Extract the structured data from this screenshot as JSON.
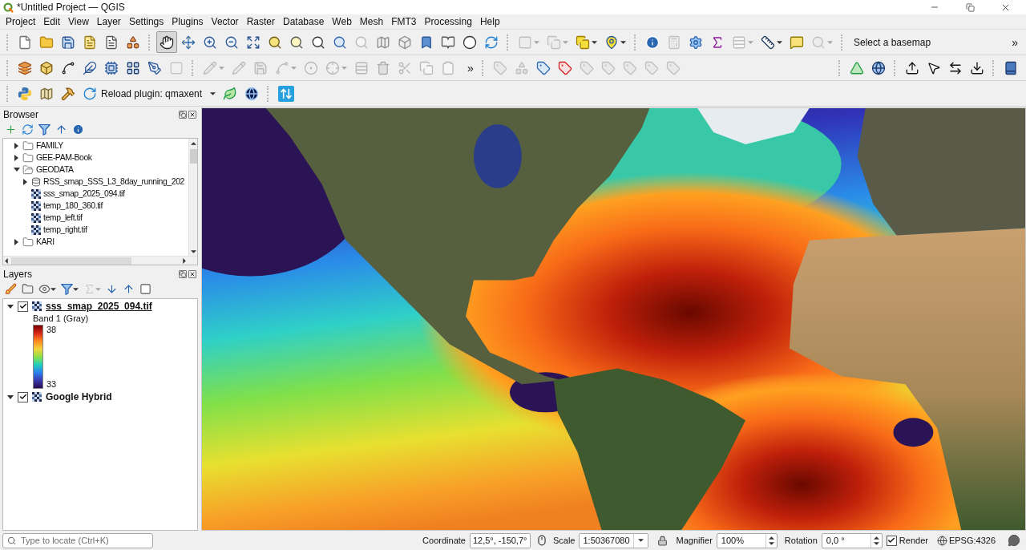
{
  "window": {
    "title": "*Untitled Project — QGIS"
  },
  "menu": [
    "Project",
    "Edit",
    "View",
    "Layer",
    "Settings",
    "Plugins",
    "Vector",
    "Raster",
    "Database",
    "Web",
    "Mesh",
    "FMT3",
    "Processing",
    "Help"
  ],
  "toolbars": [
    {
      "groups": [
        {
          "buttons": [
            {
              "kind": "new",
              "disabled": false
            },
            {
              "kind": "open",
              "disabled": false
            },
            {
              "kind": "save",
              "disabled": false
            },
            {
              "kind": "layout",
              "disabled": false
            },
            {
              "kind": "layouts",
              "disabled": false
            },
            {
              "kind": "styles",
              "disabled": false
            }
          ]
        },
        {
          "buttons": [
            {
              "kind": "pan",
              "disabled": false,
              "selected": true
            },
            {
              "kind": "panselect",
              "disabled": false,
              "selected": false
            },
            {
              "kind": "zoomin",
              "disabled": false,
              "selected": false
            },
            {
              "kind": "zoomout",
              "disabled": false,
              "selected": false
            },
            {
              "kind": "zoomfull",
              "disabled": false,
              "selected": false
            },
            {
              "kind": "zoomlayer",
              "disabled": false,
              "selected": false
            },
            {
              "kind": "zoomselect",
              "disabled": false,
              "selected": false
            },
            {
              "kind": "zoomnative",
              "disabled": false,
              "selected": false
            },
            {
              "kind": "zoomlast",
              "disabled": false,
              "selected": false
            },
            {
              "kind": "zoomnext",
              "disabled": true,
              "selected": false
            },
            {
              "kind": "mapview",
              "disabled": false,
              "selected": false
            },
            {
              "kind": "map3d",
              "disabled": false,
              "selected": false
            },
            {
              "kind": "bookmark",
              "disabled": false,
              "selected": false
            },
            {
              "kind": "bookmarks",
              "disabled": false,
              "selected": false
            },
            {
              "kind": "temporal",
              "disabled": false,
              "selected": false
            },
            {
              "kind": "refresh",
              "disabled": false,
              "selected": false
            }
          ]
        },
        {
          "buttons": [
            {
              "kind": "select",
              "disabled": true,
              "dropdown": true
            },
            {
              "kind": "selectattr",
              "disabled": true,
              "dropdown": true
            },
            {
              "kind": "deselect",
              "disabled": false,
              "dropdown": true
            },
            {
              "kind": "selectlocation",
              "disabled": false,
              "dropdown": true
            }
          ]
        },
        {
          "buttons": [
            {
              "kind": "identify",
              "disabled": false
            },
            {
              "kind": "attrtable",
              "disabled": true
            },
            {
              "kind": "toolbox",
              "disabled": false
            },
            {
              "kind": "statistics",
              "disabled": false
            },
            {
              "kind": "fieldcalc",
              "disabled": true,
              "dropdown": true
            },
            {
              "kind": "measure",
              "disabled": false,
              "dropdown": true
            },
            {
              "kind": "annotation",
              "disabled": false
            },
            {
              "kind": "locator",
              "disabled": true,
              "dropdown": true
            }
          ]
        },
        {
          "text": "Select a basemap",
          "overflow": "»"
        }
      ]
    },
    {
      "groups": [
        {
          "buttons": [
            {
              "kind": "datasource",
              "disabled": false
            },
            {
              "kind": "geopackage",
              "disabled": false
            },
            {
              "kind": "shapefile",
              "disabled": false
            },
            {
              "kind": "scratch",
              "disabled": false
            },
            {
              "kind": "virtual",
              "disabled": false
            },
            {
              "kind": "mesh",
              "disabled": false
            },
            {
              "kind": "gpx",
              "disabled": false
            },
            {
              "kind": "vertexbox",
              "disabled": true
            }
          ]
        },
        {
          "buttons": [
            {
              "kind": "editpencil",
              "disabled": true,
              "dropdown": true
            },
            {
              "kind": "toggleedit",
              "disabled": true
            },
            {
              "kind": "saveedits",
              "disabled": true
            },
            {
              "kind": "digitize",
              "disabled": true,
              "dropdown": true
            },
            {
              "kind": "addpoints",
              "disabled": true
            },
            {
              "kind": "vertextool",
              "disabled": true,
              "dropdown": true
            },
            {
              "kind": "attredit",
              "disabled": true
            },
            {
              "kind": "delete",
              "disabled": true
            },
            {
              "kind": "cut",
              "disabled": true
            },
            {
              "kind": "copy",
              "disabled": true
            },
            {
              "kind": "paste",
              "disabled": true
            }
          ],
          "overflow": "»"
        },
        {
          "buttons": [
            {
              "kind": "labeltool",
              "disabled": true
            },
            {
              "kind": "diagram",
              "disabled": true
            },
            {
              "kind": "labelhighlight",
              "disabled": false
            },
            {
              "kind": "labelunplaced",
              "disabled": false
            },
            {
              "kind": "labelpin",
              "disabled": true
            },
            {
              "kind": "labelshow",
              "disabled": true
            },
            {
              "kind": "labelmove",
              "disabled": true
            },
            {
              "kind": "labelrotate",
              "disabled": true
            },
            {
              "kind": "labelchange",
              "disabled": true
            }
          ]
        },
        {
          "buttons": [
            {
              "kind": "triangle",
              "disabled": false
            },
            {
              "kind": "globe",
              "disabled": false
            }
          ]
        },
        {
          "buttons": [
            {
              "kind": "upload",
              "disabled": false
            },
            {
              "kind": "selectcursor",
              "disabled": false
            },
            {
              "kind": "swap",
              "disabled": false
            },
            {
              "kind": "download",
              "disabled": false
            }
          ]
        },
        {
          "buttons": [
            {
              "kind": "help",
              "disabled": false
            }
          ]
        }
      ]
    },
    {
      "groups": [
        {
          "buttons": [
            {
              "kind": "python",
              "disabled": false
            },
            {
              "kind": "mapplugin",
              "disabled": false
            },
            {
              "kind": "hammer",
              "disabled": false
            },
            {
              "kind": "reload",
              "disabled": false,
              "label": "Reload plugin: qmaxent",
              "dropdown": true
            },
            {
              "kind": "leaf",
              "disabled": false
            },
            {
              "kind": "earth",
              "disabled": false
            }
          ]
        },
        {
          "buttons": [
            {
              "kind": "updown",
              "disabled": false
            }
          ]
        }
      ]
    }
  ],
  "browser": {
    "title": "Browser",
    "tools": [
      {
        "kind": "add",
        "disabled": false
      },
      {
        "kind": "refresh",
        "disabled": false
      },
      {
        "kind": "filter",
        "disabled": false
      },
      {
        "kind": "collapse",
        "disabled": false
      },
      {
        "kind": "info",
        "disabled": false
      }
    ],
    "items": [
      {
        "kind": "folder",
        "label": "FAMILY",
        "expanded": false
      },
      {
        "kind": "folder",
        "label": "GEE-PAM-Book",
        "expanded": false
      },
      {
        "kind": "folder",
        "label": "GEODATA",
        "expanded": true,
        "children": [
          {
            "kind": "database",
            "label": "RSS_smap_SSS_L3_8day_running_202",
            "expanded": false
          },
          {
            "kind": "raster",
            "label": "sss_smap_2025_094.tif"
          },
          {
            "kind": "raster",
            "label": "temp_180_360.tif"
          },
          {
            "kind": "raster",
            "label": "temp_left.tif"
          },
          {
            "kind": "raster",
            "label": "temp_right.tif"
          }
        ]
      },
      {
        "kind": "folder",
        "label": "KARI",
        "expanded": false
      }
    ]
  },
  "layers": {
    "title": "Layers",
    "tools": [
      {
        "kind": "style",
        "disabled": false
      },
      {
        "kind": "addgroup",
        "disabled": false
      },
      {
        "kind": "visibility",
        "disabled": false,
        "dropdown": true
      },
      {
        "kind": "filter",
        "disabled": false,
        "dropdown": true
      },
      {
        "kind": "expression",
        "disabled": true,
        "dropdown": true
      },
      {
        "kind": "expand",
        "disabled": false
      },
      {
        "kind": "collapse",
        "disabled": false
      },
      {
        "kind": "remove",
        "disabled": false
      }
    ],
    "items": [
      {
        "label": "sss_smap_2025_094.tif",
        "checked": true,
        "expanded": true,
        "underlined": true,
        "legend": {
          "title": "Band 1 (Gray)",
          "max": "38",
          "min": "33"
        }
      },
      {
        "label": "Google Hybrid",
        "checked": true,
        "expanded": true,
        "underlined": false
      }
    ]
  },
  "status_bar": {
    "locator": {
      "placeholder": "Type to locate (Ctrl+K)"
    },
    "coordinate": {
      "label": "Coordinate",
      "value": "12,5°, -150,7°"
    },
    "scale": {
      "label": "Scale",
      "value": "1:50367080"
    },
    "magnifier": {
      "label": "Magnifier",
      "value": "100%"
    },
    "rotation": {
      "label": "Rotation",
      "value": "0,0 °"
    },
    "render": {
      "label": "Render",
      "checked": true
    },
    "crs": "EPSG:4326"
  }
}
